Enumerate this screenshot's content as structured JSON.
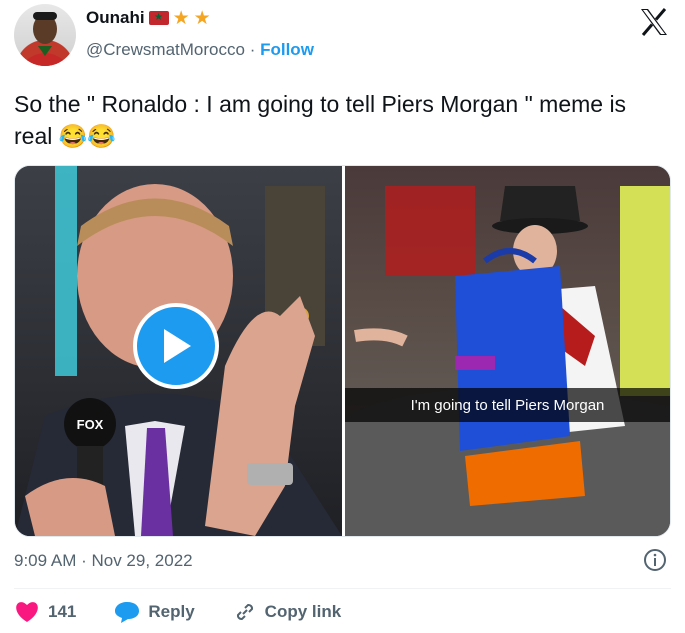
{
  "author": {
    "name": "Ounahi",
    "handle": "@CrewsmatMorocco",
    "separator": "·",
    "follow_label": "Follow",
    "badges": [
      "morocco-flag-icon",
      "star-icon",
      "star-icon"
    ]
  },
  "tweet": {
    "text": "So the \" Ronaldo : I am going to tell Piers Morgan \" meme is real 😂😂",
    "timestamp": "9:09 AM · Nov 29, 2022"
  },
  "media": {
    "caption": "I'm going to tell Piers Morgan",
    "left_logo": "FOX"
  },
  "actions": {
    "like_count": "141",
    "reply_label": "Reply",
    "copy_link_label": "Copy link"
  },
  "colors": {
    "accent": "#1d9bf0",
    "like": "#f91880",
    "text": "#0f1419",
    "muted": "#536471"
  }
}
